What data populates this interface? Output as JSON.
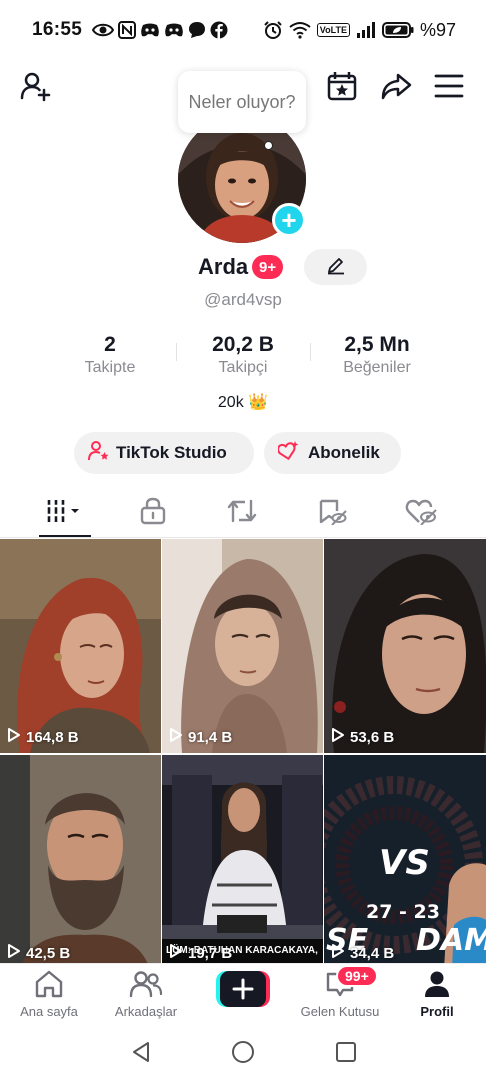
{
  "status_bar": {
    "time": "16:55",
    "battery": "%97",
    "network": "VoLTE",
    "left_icons": [
      "eye-icon",
      "nfc-icon",
      "discord-icon",
      "discord-icon",
      "chat-bubble-icon",
      "facebook-icon"
    ],
    "right_icons": [
      "alarm-icon",
      "wifi-icon",
      "volte-icon",
      "signal-icon",
      "battery-icon"
    ]
  },
  "header": {
    "icons": [
      "add-friend-icon",
      "calendar-star-icon",
      "share-icon",
      "menu-icon"
    ]
  },
  "note_bubble": {
    "text": "Neler oluyor?"
  },
  "profile": {
    "name": "Arda",
    "badge": "9+",
    "username": "@ard4vsp",
    "bio": "20k 👑"
  },
  "stats": [
    {
      "value": "2",
      "label": "Takipte"
    },
    {
      "value": "20,2 B",
      "label": "Takipçi"
    },
    {
      "value": "2,5 Mn",
      "label": "Beğeniler"
    }
  ],
  "actions": {
    "studio_label": "TikTok Studio",
    "subscription_label": "Abonelik"
  },
  "tabs": [
    "videos-grid-icon",
    "lock-icon",
    "repost-icon",
    "favorites-icon",
    "liked-icon"
  ],
  "videos": [
    {
      "views": "164,8 B"
    },
    {
      "views": "91,4 B"
    },
    {
      "views": "53,6 B"
    },
    {
      "views": "42,5 B"
    },
    {
      "views": "19,7 B",
      "overlay_text": "LÜM: BATUHAN KARACAKAYA,"
    },
    {
      "views": "34,4 B",
      "overlay_vs": "VS",
      "overlay_score": "27 - 23",
      "overlay_left": "SE",
      "overlay_right": "DAMI"
    }
  ],
  "bottom_nav": {
    "home": "Ana sayfa",
    "friends": "Arkadaşlar",
    "inbox": "Gelen Kutusu",
    "inbox_badge": "99+",
    "profile": "Profil"
  },
  "colors": {
    "accent_red": "#fe2c55",
    "accent_cyan": "#25f4ee",
    "story_add": "#20d5ec",
    "text_primary": "#161823",
    "text_secondary": "#8a8b91"
  }
}
